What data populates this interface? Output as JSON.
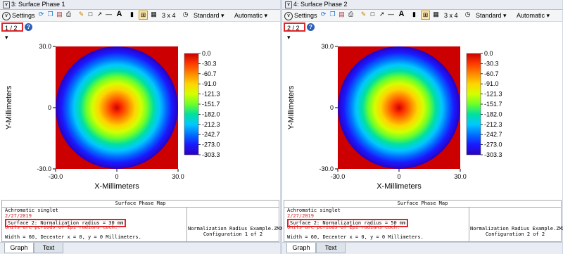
{
  "panels": [
    {
      "title": "3: Surface Phase 1",
      "toolbar": {
        "settings_label": "Settings",
        "layout_label": "3 x 4",
        "standard_label": "Standard",
        "automatic_label": "Automatic"
      },
      "page_selector": "1 / 2",
      "help_label": "?",
      "chart_data": {
        "type": "heatmap",
        "xlabel": "X-Millimeters",
        "ylabel": "Y-Millimeters",
        "x_ticks": [
          "-30.0",
          "0",
          "30.0"
        ],
        "y_ticks": [
          "30.0",
          "0",
          "-30.0"
        ],
        "xlim": [
          -30,
          30
        ],
        "ylim": [
          -30,
          30
        ],
        "colorbar_ticks": [
          "0.0",
          "-30.3",
          "-60.7",
          "-91.0",
          "-121.3",
          "-151.7",
          "-182.0",
          "-212.3",
          "-242.7",
          "-273.0",
          "-303.3"
        ],
        "colorbar_range": [
          -303.3,
          0.0
        ],
        "circle_radius": 30,
        "center_value": 0.0,
        "edge_value": -303.3,
        "colors": [
          "#cc0000",
          "#ff3a00",
          "#ff8800",
          "#ffd400",
          "#d4ff00",
          "#6cff2a",
          "#00e0a0",
          "#00c8ff",
          "#0070ff",
          "#1a1aff",
          "#2a00c0"
        ]
      },
      "info": {
        "header": "Surface Phase Map",
        "line1": "Achromatic singlet",
        "line2": "2/27/2019",
        "line3": "Surface 2: Normalization radius = 30 mm",
        "line4": "Units are periods of 2pi radians each.",
        "line5": "Width = 60, Decenter x = 0, y = 0 Millimeters.",
        "file": "Normalization Radius Example.ZMX",
        "config": "Configuration 1 of 2"
      },
      "tabs": [
        "Graph",
        "Text"
      ]
    },
    {
      "title": "4: Surface Phase 2",
      "toolbar": {
        "settings_label": "Settings",
        "layout_label": "3 x 4",
        "standard_label": "Standard",
        "automatic_label": "Automatic"
      },
      "page_selector": "2 / 2",
      "help_label": "?",
      "chart_data": {
        "type": "heatmap",
        "xlabel": "X-Millimeters",
        "ylabel": "Y-Millimeters",
        "x_ticks": [
          "-30.0",
          "0",
          "30.0"
        ],
        "y_ticks": [
          "30.0",
          "0",
          "-30.0"
        ],
        "xlim": [
          -30,
          30
        ],
        "ylim": [
          -30,
          30
        ],
        "colorbar_ticks": [
          "0.0",
          "-30.3",
          "-60.7",
          "-91.0",
          "-121.3",
          "-151.7",
          "-182.0",
          "-212.3",
          "-242.7",
          "-273.0",
          "-303.3"
        ],
        "colorbar_range": [
          -303.3,
          0.0
        ],
        "circle_radius": 30,
        "center_value": 0.0,
        "edge_value": -303.3,
        "colors": [
          "#cc0000",
          "#ff3a00",
          "#ff8800",
          "#ffd400",
          "#d4ff00",
          "#6cff2a",
          "#00e0a0",
          "#00c8ff",
          "#0070ff",
          "#1a1aff",
          "#2a00c0"
        ]
      },
      "info": {
        "header": "Surface Phase Map",
        "line1": "Achromatic singlet",
        "line2": "2/27/2019",
        "line3": "Surface 2: Normalization radius = 50 mm",
        "line4": "Units are periods of 2pi radians each.",
        "line5": "Width = 60, Decenter x = 0, y = 0 Millimeters.",
        "file": "Normalization Radius Example.ZMX",
        "config": "Configuration 2 of 2"
      },
      "tabs": [
        "Graph",
        "Text"
      ]
    }
  ]
}
